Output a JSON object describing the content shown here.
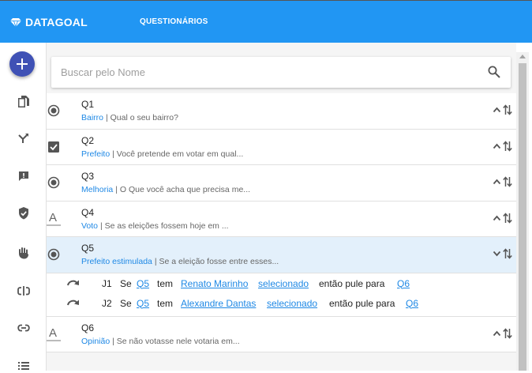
{
  "header": {
    "brand": "DATAGOAL",
    "tab": "QUESTIONÁRIOS"
  },
  "sidebar": {
    "icons": [
      "add-icon",
      "copy-icon",
      "shuffle-icon",
      "feedback-icon",
      "shield-check-icon",
      "hand-icon",
      "loop-icon",
      "link-icon",
      "list-icon"
    ]
  },
  "search": {
    "placeholder": "Buscar pelo Nome"
  },
  "questions": [
    {
      "code": "Q1",
      "tag": "Bairro",
      "text": "Qual o seu bairro?",
      "type": "radio-icon"
    },
    {
      "code": "Q2",
      "tag": "Prefeito",
      "text": "Você pretende em votar em qual...",
      "type": "checkbox-icon"
    },
    {
      "code": "Q3",
      "tag": "Melhoria",
      "text": "O Que você acha que precisa me...",
      "type": "radio-icon"
    },
    {
      "code": "Q4",
      "tag": "Voto",
      "text": "Se as eleições fossem hoje em ...",
      "type": "text-icon"
    },
    {
      "code": "Q5",
      "tag": "Prefeito estimulada",
      "text": "Se a eleição fosse entre esses...",
      "type": "radio-icon"
    },
    {
      "code": "Q6",
      "tag": "Opinião",
      "text": "Se não votasse nele votaria em...",
      "type": "text-icon"
    }
  ],
  "separator": "|",
  "jumps": [
    {
      "id": "J1",
      "se": "Se",
      "q": "Q5",
      "tem": "tem",
      "answer": "Renato Marinho",
      "state": "selecionado",
      "then": "então pule para",
      "target": "Q6"
    },
    {
      "id": "J2",
      "se": "Se",
      "q": "Q5",
      "tem": "tem",
      "answer": "Alexandre Dantas",
      "state": "selecionado",
      "then": "então pule para",
      "target": "Q6"
    }
  ],
  "colors": {
    "topbar": "#2196f3",
    "fab": "#3f51b5",
    "link": "#1e88e5",
    "active_row": "#e3f0fb"
  }
}
